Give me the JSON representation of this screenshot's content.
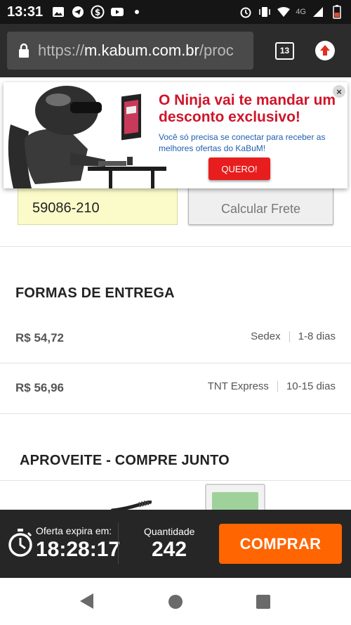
{
  "status_bar": {
    "time": "13:31",
    "network": "4G"
  },
  "browser": {
    "url_scheme": "https://",
    "url_domain": "m.kabum.com.br",
    "url_path": "/proc",
    "tab_count": "13"
  },
  "shipping": {
    "cep_value": "59086-210",
    "calc_button": "Calcular Frete",
    "section_title": "FORMAS DE ENTREGA",
    "options": [
      {
        "price": "R$ 54,72",
        "carrier": "Sedex",
        "eta": "1-8 dias"
      },
      {
        "price": "R$ 56,96",
        "carrier": "TNT Express",
        "eta": "10-15 dias"
      }
    ]
  },
  "combo": {
    "title": "APROVEITE - COMPRE JUNTO"
  },
  "popup": {
    "headline": "O Ninja vai te mandar um desconto exclusivo!",
    "body": "Você só precisa se conectar para receber as melhores ofertas do KaBuM!",
    "cta": "QUERO!",
    "close": "×"
  },
  "buy_bar": {
    "offer_label": "Oferta expira em:",
    "offer_time": "18:28:17",
    "qty_label": "Quantidade",
    "qty_value": "242",
    "buy_label": "COMPRAR"
  },
  "colors": {
    "accent_orange": "#ff6500",
    "popup_red": "#d0152a",
    "popup_blue": "#1f5fb0",
    "bar_dark": "#262626"
  }
}
